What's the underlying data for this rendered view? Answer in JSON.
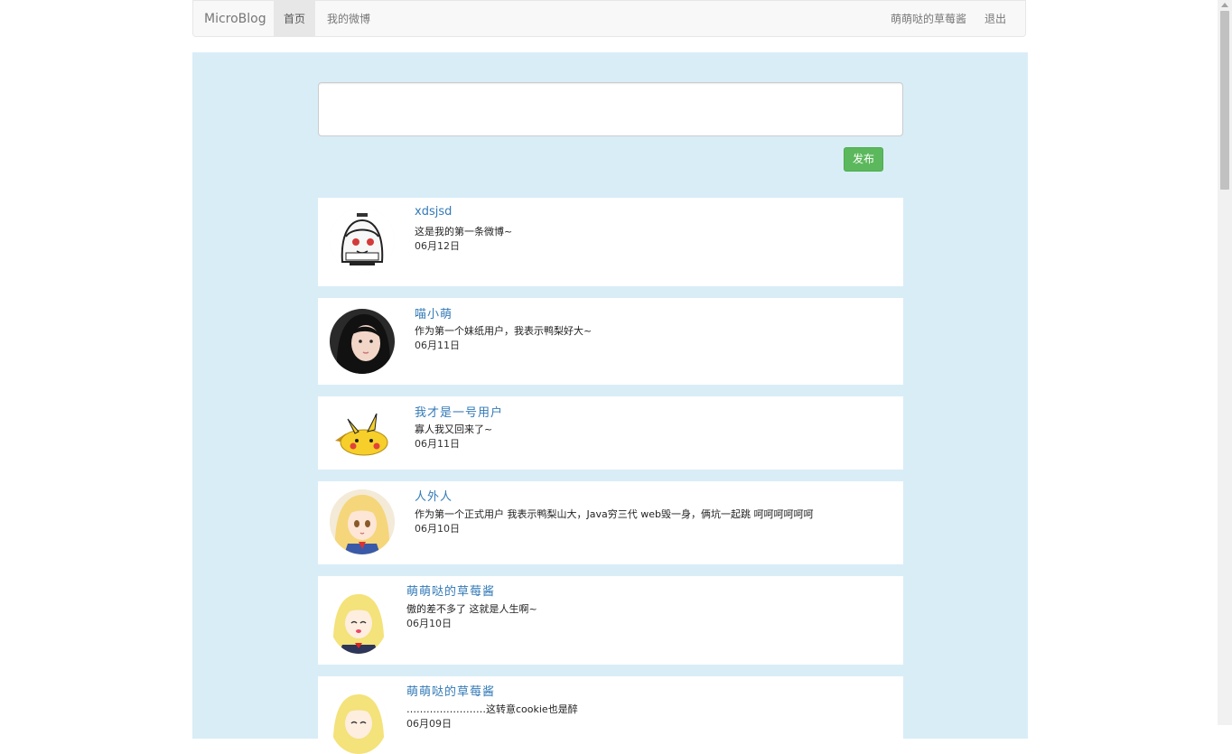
{
  "navbar": {
    "brand": "MicroBlog",
    "items": [
      {
        "label": "首页",
        "active": true
      },
      {
        "label": "我的微博",
        "active": false
      }
    ],
    "right_items": [
      {
        "label": "萌萌哒的草莓酱"
      },
      {
        "label": "退出"
      }
    ]
  },
  "composer": {
    "value": "",
    "publish_label": "发布"
  },
  "posts": [
    {
      "user": "xdsjsd",
      "text": "这是我的第一条微博~",
      "date": "06月12日",
      "avatar": "cartoon-ghost-avatar"
    },
    {
      "user": "喵小萌",
      "text": "作为第一个妹纸用户，我表示鸭梨好大~",
      "date": "06月11日",
      "avatar": "girl-photo-avatar"
    },
    {
      "user": "我才是一号用户",
      "text": "寡人我又回来了~",
      "date": "06月11日",
      "avatar": "pikachu-avatar"
    },
    {
      "user": "人外人",
      "text": "作为第一个正式用户 我表示鸭梨山大，Java穷三代 web毁一身，俩坑一起跳 呵呵呵呵呵呵",
      "date": "06月10日",
      "avatar": "anime-girl-avatar"
    },
    {
      "user": "萌萌哒的草莓酱",
      "text": "傲的差不多了 这就是人生啊~",
      "date": "06月10日",
      "avatar": "blonde-anime-avatar"
    },
    {
      "user": "萌萌哒的草莓酱",
      "text": "……………………这转意cookie也是醉",
      "date": "06月09日",
      "avatar": "blonde-anime-avatar"
    }
  ],
  "colors": {
    "panel": "#d9edf7",
    "link": "#337ab7",
    "publish": "#5cb85c"
  }
}
